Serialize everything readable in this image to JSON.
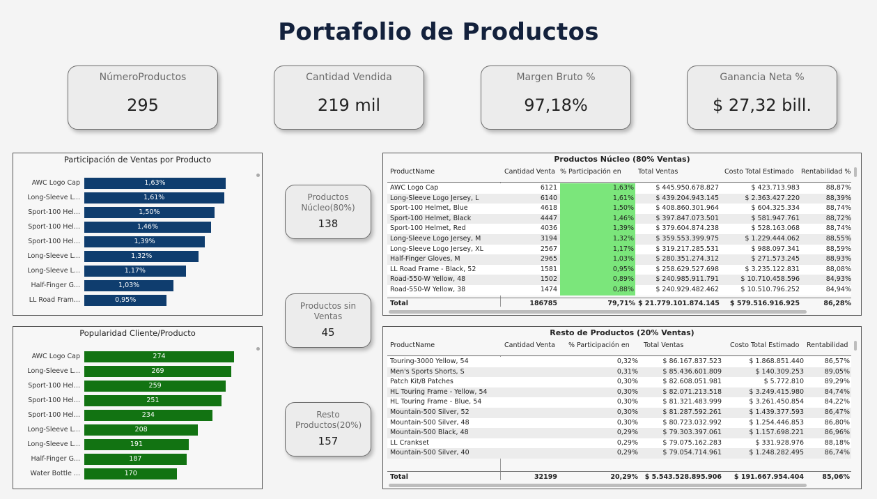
{
  "title": "Portafolio de Productos",
  "kpis": [
    {
      "label": "NúmeroProductos",
      "value": "295"
    },
    {
      "label": "Cantidad Vendida",
      "value": "219 mil"
    },
    {
      "label": "Margen Bruto %",
      "value": "97,18%"
    },
    {
      "label": "Ganancia Neta %",
      "value": "$ 27,32 bill."
    }
  ],
  "cards": [
    {
      "label": "Productos Núcleo(80%)",
      "value": "138"
    },
    {
      "label": "Productos sin Ventas",
      "value": "45"
    },
    {
      "label": "Resto Productos(20%)",
      "value": "157"
    }
  ],
  "chart_sales": {
    "title": "Participación de Ventas por Producto",
    "color": "#0f3d6e",
    "chart_data": {
      "type": "bar",
      "categories": [
        "AWC Logo Cap",
        "Long-Sleeve L...",
        "Sport-100 Hel...",
        "Sport-100 Hel...",
        "Sport-100 Hel...",
        "Long-Sleeve L...",
        "Long-Sleeve L...",
        "Half-Finger G...",
        "LL Road Fram..."
      ],
      "values": [
        1.63,
        1.61,
        1.5,
        1.46,
        1.39,
        1.32,
        1.17,
        1.03,
        0.95
      ],
      "labels": [
        "1,63%",
        "1,61%",
        "1,50%",
        "1,46%",
        "1,39%",
        "1,32%",
        "1,17%",
        "1,03%",
        "0,95%"
      ]
    }
  },
  "chart_pop": {
    "title": "Popularidad Cliente/Producto",
    "color": "#127312",
    "chart_data": {
      "type": "bar",
      "categories": [
        "AWC Logo Cap",
        "Long-Sleeve L...",
        "Sport-100 Hel...",
        "Sport-100 Hel...",
        "Sport-100 Hel...",
        "Long-Sleeve L...",
        "Long-Sleeve L...",
        "Half-Finger G...",
        "Water Bottle ..."
      ],
      "values": [
        274,
        269,
        259,
        251,
        234,
        208,
        191,
        187,
        170
      ],
      "labels": [
        "274",
        "269",
        "259",
        "251",
        "234",
        "208",
        "191",
        "187",
        "170"
      ]
    }
  },
  "table_core": {
    "title": "Productos Núcleo (80% Ventas)",
    "headers": [
      "ProductName",
      "Cantidad Venta",
      "% Participación en Ventas",
      "Total Ventas",
      "Costo Total Estimado",
      "Rentabilidad %"
    ],
    "rows": [
      [
        "AWC Logo Cap",
        "6121",
        "1,63%",
        "$ 445.950.678.827",
        "$ 423.713.983",
        "88,87%"
      ],
      [
        "Long-Sleeve Logo Jersey, L",
        "6140",
        "1,61%",
        "$ 439.204.943.145",
        "$ 2.363.427.220",
        "88,39%"
      ],
      [
        "Sport-100 Helmet, Blue",
        "4618",
        "1,50%",
        "$ 408.860.301.964",
        "$ 604.325.334",
        "88,74%"
      ],
      [
        "Sport-100 Helmet, Black",
        "4447",
        "1,46%",
        "$ 397.847.073.501",
        "$ 581.947.761",
        "88,72%"
      ],
      [
        "Sport-100 Helmet, Red",
        "4036",
        "1,39%",
        "$ 379.604.874.238",
        "$ 528.163.068",
        "88,74%"
      ],
      [
        "Long-Sleeve Logo Jersey, M",
        "3194",
        "1,32%",
        "$ 359.553.399.975",
        "$ 1.229.444.062",
        "88,55%"
      ],
      [
        "Long-Sleeve Logo Jersey, XL",
        "2567",
        "1,17%",
        "$ 319.217.285.531",
        "$ 988.097.341",
        "88,59%"
      ],
      [
        "Half-Finger Gloves, M",
        "2965",
        "1,03%",
        "$ 280.351.274.312",
        "$ 271.573.245",
        "88,93%"
      ],
      [
        "LL Road Frame - Black, 52",
        "1581",
        "0,95%",
        "$ 258.629.527.698",
        "$ 3.235.122.831",
        "88,08%"
      ],
      [
        "Road-550-W Yellow, 48",
        "1502",
        "0,89%",
        "$ 240.985.911.791",
        "$ 10.710.458.596",
        "84,93%"
      ],
      [
        "Road-550-W Yellow, 38",
        "1474",
        "0,88%",
        "$ 240.929.482.462",
        "$ 10.510.796.252",
        "84,94%"
      ]
    ],
    "total": [
      "Total",
      "186785",
      "79,71%",
      "$ 21.779.101.874.145",
      "$ 579.516.916.925",
      "86,28%"
    ]
  },
  "table_rest": {
    "title": "Resto de Productos  (20% Ventas)",
    "headers": [
      "ProductName",
      "Cantidad Venta",
      "% Participación en Ventas",
      "Total Ventas",
      "Costo Total Estimado",
      "Rentabilidad %"
    ],
    "rows": [
      [
        "Touring-3000 Yellow, 54",
        "",
        "0,32%",
        "$ 86.167.837.523",
        "$ 1.868.851.440",
        "86,57%"
      ],
      [
        "Men's Sports Shorts, S",
        "",
        "0,31%",
        "$ 85.436.601.809",
        "$ 140.309.253",
        "89,05%"
      ],
      [
        "Patch Kit/8 Patches",
        "",
        "0,30%",
        "$ 82.608.051.981",
        "$ 5.772.810",
        "89,29%"
      ],
      [
        "HL Touring Frame - Yellow, 54",
        "",
        "0,30%",
        "$ 82.071.213.518",
        "$ 3.249.415.980",
        "84,74%"
      ],
      [
        "HL Touring Frame - Blue, 54",
        "",
        "0,30%",
        "$ 81.321.483.999",
        "$ 3.261.450.854",
        "84,22%"
      ],
      [
        "Mountain-500 Silver, 52",
        "",
        "0,30%",
        "$ 81.287.592.261",
        "$ 1.439.377.593",
        "86,47%"
      ],
      [
        "Mountain-500 Silver, 48",
        "",
        "0,30%",
        "$ 80.723.032.992",
        "$ 1.254.446.853",
        "86,80%"
      ],
      [
        "Mountain-500 Black, 48",
        "",
        "0,29%",
        "$ 79.303.397.061",
        "$ 1.157.698.221",
        "86,96%"
      ],
      [
        "LL Crankset",
        "",
        "0,29%",
        "$ 79.075.162.283",
        "$ 331.928.976",
        "88,18%"
      ],
      [
        "Mountain-500 Silver, 40",
        "",
        "0,29%",
        "$ 79.054.714.961",
        "$ 1.248.282.495",
        "86,74%"
      ]
    ],
    "total": [
      "Total",
      "32199",
      "20,29%",
      "$ 5.543.528.895.906",
      "$ 191.667.954.404",
      "85,06%"
    ]
  }
}
